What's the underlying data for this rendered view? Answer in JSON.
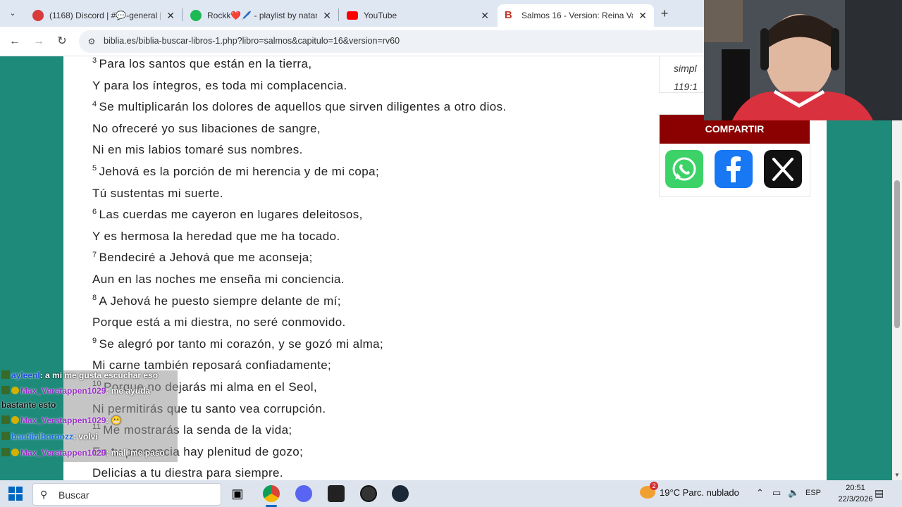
{
  "browser": {
    "tabs": [
      {
        "title": "(1168) Discord | #💬-general |",
        "favicon_color": "#d83b3b"
      },
      {
        "title": "Rockk❤️🖊️ - playlist by natanc",
        "favicon_color": "#1db954"
      },
      {
        "title": "YouTube",
        "favicon_color": "#ff0000"
      },
      {
        "title": "Salmos 16 - Version: Reina Vale",
        "favicon_color": "#c0392b",
        "active": true
      }
    ],
    "url": "biblia.es/biblia-buscar-libros-1.php?libro=salmos&capitulo=16&version=rv60"
  },
  "verses": [
    {
      "num": "3",
      "text": "Para los santos que están en la tierra,"
    },
    {
      "num": "",
      "text": "Y para los íntegros, es toda mi complacencia."
    },
    {
      "num": "4",
      "text": "Se multiplicarán los dolores de aquellos que sirven diligentes a otro dios."
    },
    {
      "num": "",
      "text": "No ofreceré yo sus libaciones de sangre,"
    },
    {
      "num": "",
      "text": "Ni en mis labios tomaré sus nombres."
    },
    {
      "num": "5",
      "text": "Jehová es la porción de mi herencia y de mi copa;"
    },
    {
      "num": "",
      "text": "Tú sustentas mi suerte."
    },
    {
      "num": "6",
      "text": "Las cuerdas me cayeron en lugares deleitosos,"
    },
    {
      "num": "",
      "text": "Y es hermosa la heredad que me ha tocado."
    },
    {
      "num": "7",
      "text": "Bendeciré a Jehová que me aconseja;"
    },
    {
      "num": "",
      "text": "Aun en las noches me enseña mi conciencia."
    },
    {
      "num": "8",
      "text": "A Jehová he puesto siempre delante de mí;"
    },
    {
      "num": "",
      "text": "Porque está a mi diestra, no seré conmovido."
    },
    {
      "num": "9",
      "text": "Se alegró por tanto mi corazón, y se gozó mi alma;"
    },
    {
      "num": "",
      "text": "Mi carne también reposará confiadamente;"
    },
    {
      "num": "10",
      "text": "Porque no dejarás mi alma en el Seol,"
    },
    {
      "num": "",
      "text": "Ni permitirás que tu santo vea corrupción."
    },
    {
      "num": "11",
      "text": "Me mostrarás la senda de la vida;"
    },
    {
      "num": "",
      "text": "En tu presencia hay plenitud de gozo;"
    },
    {
      "num": "",
      "text": "Delicias a tu diestra para siempre."
    }
  ],
  "sidebar": {
    "ref_line1": "simpl",
    "ref_line2": "119:1",
    "share_title": "COMPARTIR",
    "buttons": [
      "whatsapp",
      "facebook",
      "x"
    ]
  },
  "chat": [
    {
      "user": "ayleenl",
      "msg": ": a mi me gusta escuchar eso",
      "color": "#1e4fd8"
    },
    {
      "user": "Max_Verstappen1029",
      "msg": ": me ayuda",
      "color": "#9b30c8"
    },
    {
      "user": "",
      "msg": "bastante esto",
      "color": "#ffffff"
    },
    {
      "user": "Max_Verstappen1029",
      "msg": ": 😬",
      "color": "#9b30c8"
    },
    {
      "user": "bautiialbornozz",
      "msg": ": volvi",
      "color": "#1e6fd8"
    },
    {
      "user": "Max_Verstappen1029",
      "msg": ": mall me paso",
      "color": "#9b30c8"
    }
  ],
  "taskbar": {
    "search_placeholder": "Buscar",
    "weather": "19°C  Parc. nublado",
    "lang": "ESP",
    "time": "20:51",
    "date": "22/3/2026",
    "weather_badge": "2"
  }
}
